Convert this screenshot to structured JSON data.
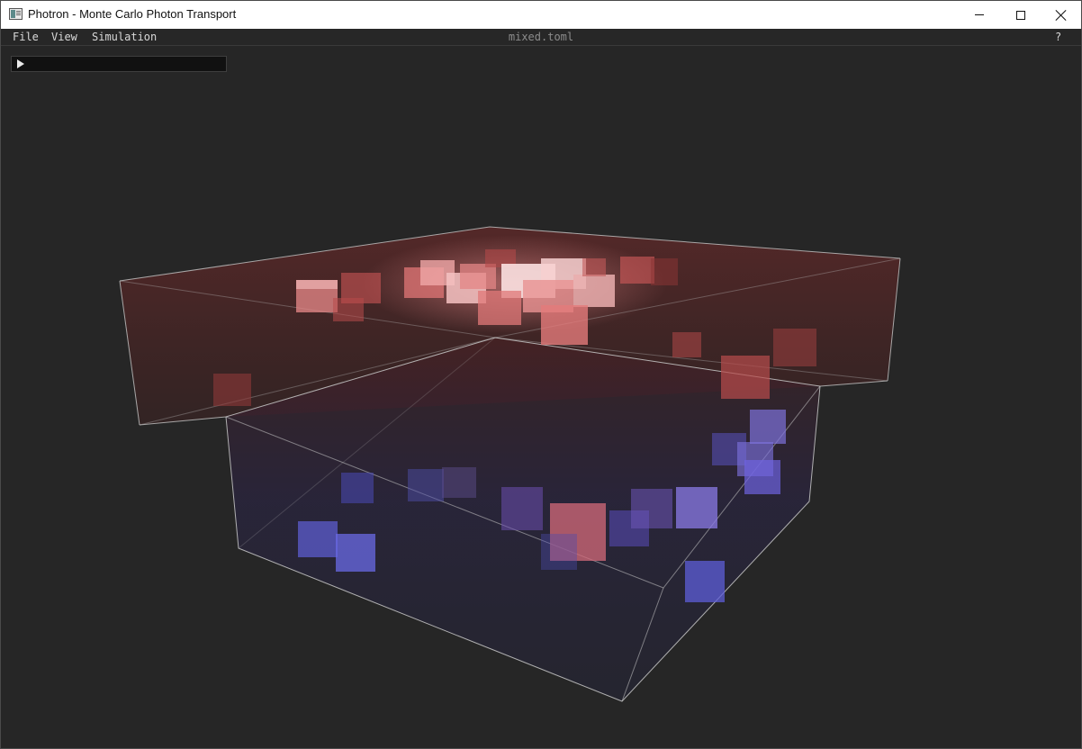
{
  "window": {
    "title": "Photron - Monte Carlo Photon Transport"
  },
  "menubar": {
    "items": [
      "File",
      "View",
      "Simulation"
    ],
    "filename": "mixed.toml",
    "help": "?"
  },
  "playback": {
    "play_icon": "play-icon"
  },
  "viewport": {
    "description_icons": [
      "volume-bounding-box",
      "voxel-cubes"
    ],
    "colors": {
      "background": "#262626",
      "box_edge": "#c8c8c8",
      "hot_voxel": "#e06a6a",
      "cold_voxel": "#6a6ae0"
    }
  }
}
